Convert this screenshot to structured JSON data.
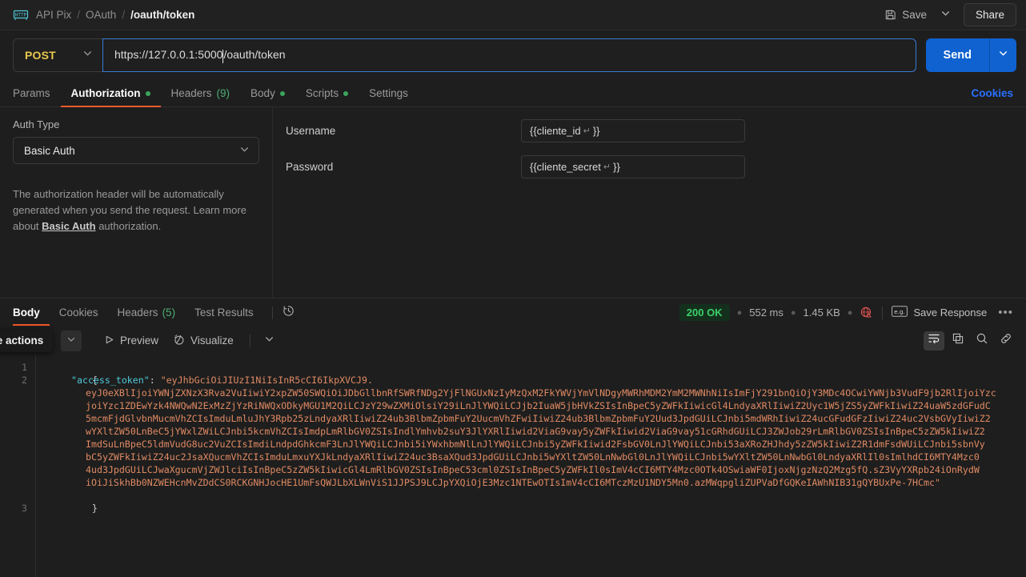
{
  "topbar": {
    "logo_icon": "http-icon",
    "breadcrumb": [
      "API Pix",
      "OAuth",
      "/oauth/token"
    ],
    "separator": "/",
    "save_label": "Save",
    "save_icon": "floppy-disk-icon",
    "save_chevron_icon": "chevron-down-icon",
    "share_label": "Share"
  },
  "request": {
    "method": "POST",
    "method_chevron_icon": "chevron-down-icon",
    "url_prefix": "https://127.0.0.1:5000",
    "url_suffix": "/oauth/token",
    "send_label": "Send",
    "send_chevron_icon": "chevron-down-icon"
  },
  "request_tabs": [
    {
      "label": "Params",
      "active": false,
      "dot": false,
      "count": ""
    },
    {
      "label": "Authorization",
      "active": true,
      "dot": true,
      "count": ""
    },
    {
      "label": "Headers",
      "active": false,
      "dot": false,
      "count": "(9)"
    },
    {
      "label": "Body",
      "active": false,
      "dot": true,
      "count": ""
    },
    {
      "label": "Scripts",
      "active": false,
      "dot": true,
      "count": ""
    },
    {
      "label": "Settings",
      "active": false,
      "dot": false,
      "count": ""
    }
  ],
  "cookies_link": "Cookies",
  "auth": {
    "type_label": "Auth Type",
    "type_value": "Basic Auth",
    "type_chevron_icon": "chevron-down-icon",
    "help_before": "The authorization header will be automatically generated when you send the request. Learn more about ",
    "help_link": "Basic Auth",
    "help_after": " authorization.",
    "username_label": "Username",
    "username_value_open": "{{cliente_id",
    "username_value_close": "}}",
    "password_label": "Password",
    "password_value_open": "{{cliente_secret",
    "password_value_close": "}}",
    "return_glyph": "↵"
  },
  "response_tabs": [
    {
      "label": "Body",
      "active": true,
      "count": ""
    },
    {
      "label": "Cookies",
      "active": false,
      "count": ""
    },
    {
      "label": "Headers",
      "active": false,
      "count": "(5)"
    },
    {
      "label": "Test Results",
      "active": false,
      "count": ""
    }
  ],
  "response_history_icon": "clock-history-icon",
  "response_meta": {
    "status": "200 OK",
    "time": "552 ms",
    "size": "1.45 KB",
    "network_icon": "globe-warning-icon",
    "save_response_icon": "save-response-icon",
    "save_response_label": "Save Response",
    "more_label": "•••"
  },
  "body_toolbar": {
    "tooltip": "w more actions",
    "ghost_chevron_icon": "chevron-down-icon",
    "preview_icon": "play-triangle-icon",
    "preview_label": "Preview",
    "visualize_icon": "visualize-icon",
    "visualize_label": "Visualize",
    "visualize_chevron_icon": "chevron-down-icon",
    "wrap_icon": "word-wrap-icon",
    "copy_icon": "copy-icon",
    "search_icon": "search-icon",
    "link_icon": "link-icon"
  },
  "code": {
    "line_numbers": [
      "1",
      "2",
      "3"
    ],
    "open_brace": "{",
    "close_brace": "}",
    "key": "\"access_token\"",
    "colon": ":",
    "value_first_line": "\"eyJhbGciOiJIUzI1NiIsInR5cCI6IkpXVCJ9.",
    "value_wrapped_lines": [
      "eyJ0eXBlIjoiYWNjZXNzX3Rva2VuIiwiY2xpZW50SWQiOiJDbGllbnRfSWRfNDg2YjFlNGUxNzIyMzQxM2FkYWVjYmVlNDgyMWRhMDM2YmM2MWNhNiIsImFjY291bnQiOjY3MDc4OCwiYWNjb3VudF9jb2RlIjoiYzc",
      "joiYzc1ZDEwYzk4NWQwN2ExMzZjYzRiNWQxODkyMGU1M2QiLCJzY29wZXMiOlsiY29iLnJlYWQiLCJjb2IuaW5jbHVkZSIsInBpeC5yZWFkIiwicGl4LndyaXRlIiwiZ2Uyc1W5jZS5yZWFkIiwiZ24uaW5zdGFudC",
      "5mcmFjdGlvbnMucmVhZCIsImduLmluJhY3Rpb25zLndyaXRlIiwiZ24ub3BlbmZpbmFuY2UucmVhZFwiIiwiZ24ub3BlbmZpbmFuY2Uud3JpdGUiLCJnbi5mdWRhIiwiZ24ucGFudGFzIiwiZ24uc2VsbGVyIiwiZ2",
      "wYXltZW50LnBeC5jYWxlZWiLCJnbi5kcmVhZCIsImdpLmRlbGV0ZSIsIndlYmhvb2suY3JlYXRlIiwid2ViaG9vay5yZWFkIiwid2ViaG9vay51cGRhdGUiLCJ3ZWJob29rLmRlbGV0ZSIsInBpeC5zZW5kIiwiZ2",
      "ImdSuLnBpeC5ldmVudG8uc2VuZCIsImdiLndpdGhkcmF3LnJlYWQiLCJnbi5iYWxhbmNlLnJlYWQiLCJnbi5yZWFkIiwid2FsbGV0LnJlYWQiLCJnbi53aXRoZHJhdy5zZW5kIiwiZ2R1dmFsdWUiLCJnbi5sbnVy",
      "bC5yZWFkIiwiZ24uc2JsaXQucmVhZCIsImduLmxuYXJkLndyaXRlIiwiZ24uc3BsaXQud3JpdGUiLCJnbi5wYXltZW50LnNwbGl0LnJlYWQiLCJnbi5wYXltZW50LnNwbGl0LndyaXRlIl0sImlhdCI6MTY4Mzc0",
      "4ud3JpdGUiLCJwaXgucmVjZWJlciIsInBpeC5zZW5kIiwicGl4LmRlbGV0ZSIsInBpeC53cml0ZSIsInBpeC5yZWFkIl0sImV4cCI6MTY4Mzc0OTk4OSwiaWF0IjoxNjgzNzQ2Mzg5fQ.sZ3VyYXRpb24iOnRydW",
      "iOiJiSkhBb0NZWEHcnMvZDdCS0RCKGNHJocHE1UmFsQWJLbXLWnViS1JJPSJ9LCJpYXQiOjE3Mzc1NTEwOTIsImV4cCI6MTczMzU1NDY5Mn0.azMWqpgliZUPVaDfGQKeIAWhNIB31gQYBUxPe-7HCmc\""
    ]
  }
}
